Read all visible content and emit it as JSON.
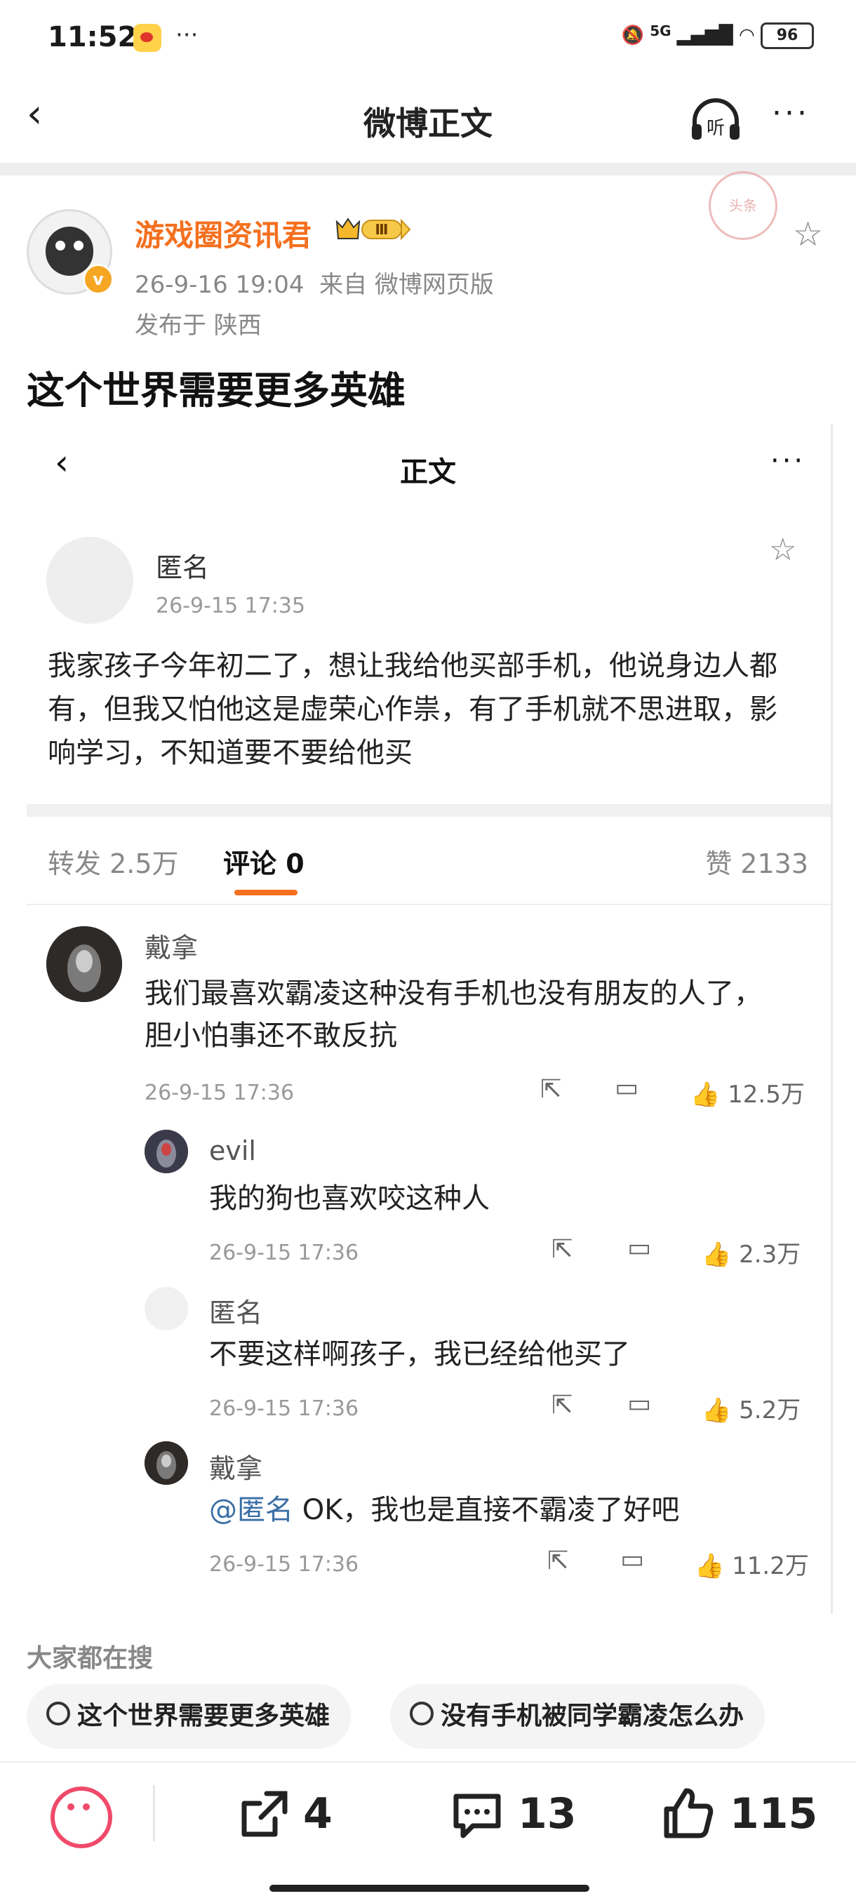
{
  "status_bar": {
    "time": "11:52",
    "dots": "···",
    "network": "5G",
    "battery": "96"
  },
  "header": {
    "title": "微博正文",
    "back": "‹",
    "more": "···",
    "listen": "听"
  },
  "post": {
    "author": "游戏圈资讯君",
    "badge": "Ⅲ",
    "date": "26-9-16 19:04",
    "source": "来自 微博网页版",
    "location": "发布于 陕西",
    "stamp": "头条",
    "headline": "这个世界需要更多英雄"
  },
  "embed": {
    "title": "正文",
    "poster_name": "匿名",
    "poster_date": "26-9-15 17:35",
    "body": "我家孩子今年初二了，想让我给他买部手机，他说身边人都有，但我又怕他这是虚荣心作祟，有了手机就不思进取，影响学习，不知道要不要给他买",
    "tabs": {
      "forward": "转发 2.5万",
      "comment": "评论 0",
      "like": "赞 2133"
    },
    "comments": [
      {
        "name": "戴拿",
        "text": "我们最喜欢霸凌这种没有手机也没有朋友的人了，胆小怕事还不敢反抗",
        "date": "26-9-15 17:36",
        "likes": "12.5万"
      },
      {
        "name": "evil",
        "text": "我的狗也喜欢咬这种人",
        "date": "26-9-15 17:36",
        "likes": "2.3万"
      },
      {
        "name": "匿名",
        "text": "不要这样啊孩子，我已经给他买了",
        "date": "26-9-15 17:36",
        "likes": "5.2万"
      },
      {
        "name": "戴拿",
        "mention": "@匿名",
        "text": " OK，我也是直接不霸凌了好吧",
        "date": "26-9-15 17:36",
        "likes": "11.2万"
      }
    ]
  },
  "hot_search": {
    "label": "大家都在搜",
    "items": [
      "这个世界需要更多英雄",
      "没有手机被同学霸凌怎么办"
    ]
  },
  "bottom_bar": {
    "share_count": "4",
    "comment_count": "13",
    "like_count": "115"
  },
  "colors": {
    "accent": "#f4701f",
    "mention": "#3a6ea5",
    "emoji": "#f04a6a"
  }
}
